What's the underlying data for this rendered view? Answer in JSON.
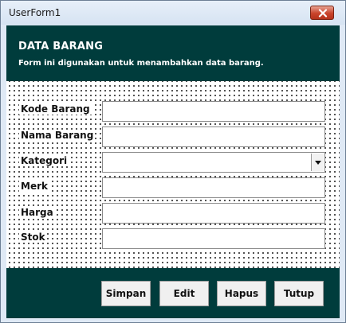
{
  "window": {
    "title": "UserForm1"
  },
  "header": {
    "title": "DATA BARANG",
    "subtitle": "Form ini digunakan untuk menambahkan data barang."
  },
  "fields": [
    {
      "label": "Kode Barang",
      "value": ""
    },
    {
      "label": "Nama Barang",
      "value": ""
    },
    {
      "label": "Kategori",
      "value": ""
    },
    {
      "label": "Merk",
      "value": ""
    },
    {
      "label": "Harga",
      "value": ""
    },
    {
      "label": "Stok",
      "value": ""
    }
  ],
  "buttons": {
    "simpan": "Simpan",
    "edit": "Edit",
    "hapus": "Hapus",
    "tutup": "Tutup"
  },
  "colors": {
    "header_bg": "#003c3c",
    "header_text": "#ffffff",
    "close_button": "#c9432b"
  },
  "icons": {
    "close": "close-icon",
    "dropdown": "chevron-down-icon"
  }
}
